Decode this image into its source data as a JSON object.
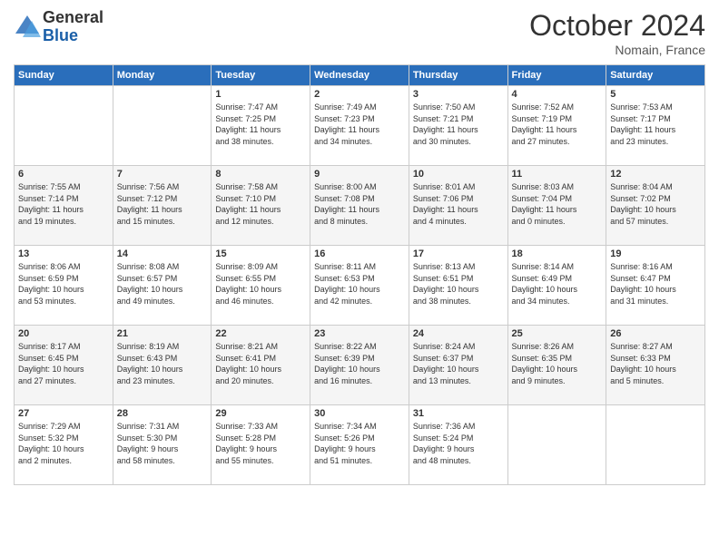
{
  "logo": {
    "general": "General",
    "blue": "Blue"
  },
  "title": "October 2024",
  "subtitle": "Nomain, France",
  "days_header": [
    "Sunday",
    "Monday",
    "Tuesday",
    "Wednesday",
    "Thursday",
    "Friday",
    "Saturday"
  ],
  "weeks": [
    [
      {
        "day": "",
        "info": ""
      },
      {
        "day": "",
        "info": ""
      },
      {
        "day": "1",
        "info": "Sunrise: 7:47 AM\nSunset: 7:25 PM\nDaylight: 11 hours\nand 38 minutes."
      },
      {
        "day": "2",
        "info": "Sunrise: 7:49 AM\nSunset: 7:23 PM\nDaylight: 11 hours\nand 34 minutes."
      },
      {
        "day": "3",
        "info": "Sunrise: 7:50 AM\nSunset: 7:21 PM\nDaylight: 11 hours\nand 30 minutes."
      },
      {
        "day": "4",
        "info": "Sunrise: 7:52 AM\nSunset: 7:19 PM\nDaylight: 11 hours\nand 27 minutes."
      },
      {
        "day": "5",
        "info": "Sunrise: 7:53 AM\nSunset: 7:17 PM\nDaylight: 11 hours\nand 23 minutes."
      }
    ],
    [
      {
        "day": "6",
        "info": "Sunrise: 7:55 AM\nSunset: 7:14 PM\nDaylight: 11 hours\nand 19 minutes."
      },
      {
        "day": "7",
        "info": "Sunrise: 7:56 AM\nSunset: 7:12 PM\nDaylight: 11 hours\nand 15 minutes."
      },
      {
        "day": "8",
        "info": "Sunrise: 7:58 AM\nSunset: 7:10 PM\nDaylight: 11 hours\nand 12 minutes."
      },
      {
        "day": "9",
        "info": "Sunrise: 8:00 AM\nSunset: 7:08 PM\nDaylight: 11 hours\nand 8 minutes."
      },
      {
        "day": "10",
        "info": "Sunrise: 8:01 AM\nSunset: 7:06 PM\nDaylight: 11 hours\nand 4 minutes."
      },
      {
        "day": "11",
        "info": "Sunrise: 8:03 AM\nSunset: 7:04 PM\nDaylight: 11 hours\nand 0 minutes."
      },
      {
        "day": "12",
        "info": "Sunrise: 8:04 AM\nSunset: 7:02 PM\nDaylight: 10 hours\nand 57 minutes."
      }
    ],
    [
      {
        "day": "13",
        "info": "Sunrise: 8:06 AM\nSunset: 6:59 PM\nDaylight: 10 hours\nand 53 minutes."
      },
      {
        "day": "14",
        "info": "Sunrise: 8:08 AM\nSunset: 6:57 PM\nDaylight: 10 hours\nand 49 minutes."
      },
      {
        "day": "15",
        "info": "Sunrise: 8:09 AM\nSunset: 6:55 PM\nDaylight: 10 hours\nand 46 minutes."
      },
      {
        "day": "16",
        "info": "Sunrise: 8:11 AM\nSunset: 6:53 PM\nDaylight: 10 hours\nand 42 minutes."
      },
      {
        "day": "17",
        "info": "Sunrise: 8:13 AM\nSunset: 6:51 PM\nDaylight: 10 hours\nand 38 minutes."
      },
      {
        "day": "18",
        "info": "Sunrise: 8:14 AM\nSunset: 6:49 PM\nDaylight: 10 hours\nand 34 minutes."
      },
      {
        "day": "19",
        "info": "Sunrise: 8:16 AM\nSunset: 6:47 PM\nDaylight: 10 hours\nand 31 minutes."
      }
    ],
    [
      {
        "day": "20",
        "info": "Sunrise: 8:17 AM\nSunset: 6:45 PM\nDaylight: 10 hours\nand 27 minutes."
      },
      {
        "day": "21",
        "info": "Sunrise: 8:19 AM\nSunset: 6:43 PM\nDaylight: 10 hours\nand 23 minutes."
      },
      {
        "day": "22",
        "info": "Sunrise: 8:21 AM\nSunset: 6:41 PM\nDaylight: 10 hours\nand 20 minutes."
      },
      {
        "day": "23",
        "info": "Sunrise: 8:22 AM\nSunset: 6:39 PM\nDaylight: 10 hours\nand 16 minutes."
      },
      {
        "day": "24",
        "info": "Sunrise: 8:24 AM\nSunset: 6:37 PM\nDaylight: 10 hours\nand 13 minutes."
      },
      {
        "day": "25",
        "info": "Sunrise: 8:26 AM\nSunset: 6:35 PM\nDaylight: 10 hours\nand 9 minutes."
      },
      {
        "day": "26",
        "info": "Sunrise: 8:27 AM\nSunset: 6:33 PM\nDaylight: 10 hours\nand 5 minutes."
      }
    ],
    [
      {
        "day": "27",
        "info": "Sunrise: 7:29 AM\nSunset: 5:32 PM\nDaylight: 10 hours\nand 2 minutes."
      },
      {
        "day": "28",
        "info": "Sunrise: 7:31 AM\nSunset: 5:30 PM\nDaylight: 9 hours\nand 58 minutes."
      },
      {
        "day": "29",
        "info": "Sunrise: 7:33 AM\nSunset: 5:28 PM\nDaylight: 9 hours\nand 55 minutes."
      },
      {
        "day": "30",
        "info": "Sunrise: 7:34 AM\nSunset: 5:26 PM\nDaylight: 9 hours\nand 51 minutes."
      },
      {
        "day": "31",
        "info": "Sunrise: 7:36 AM\nSunset: 5:24 PM\nDaylight: 9 hours\nand 48 minutes."
      },
      {
        "day": "",
        "info": ""
      },
      {
        "day": "",
        "info": ""
      }
    ]
  ]
}
